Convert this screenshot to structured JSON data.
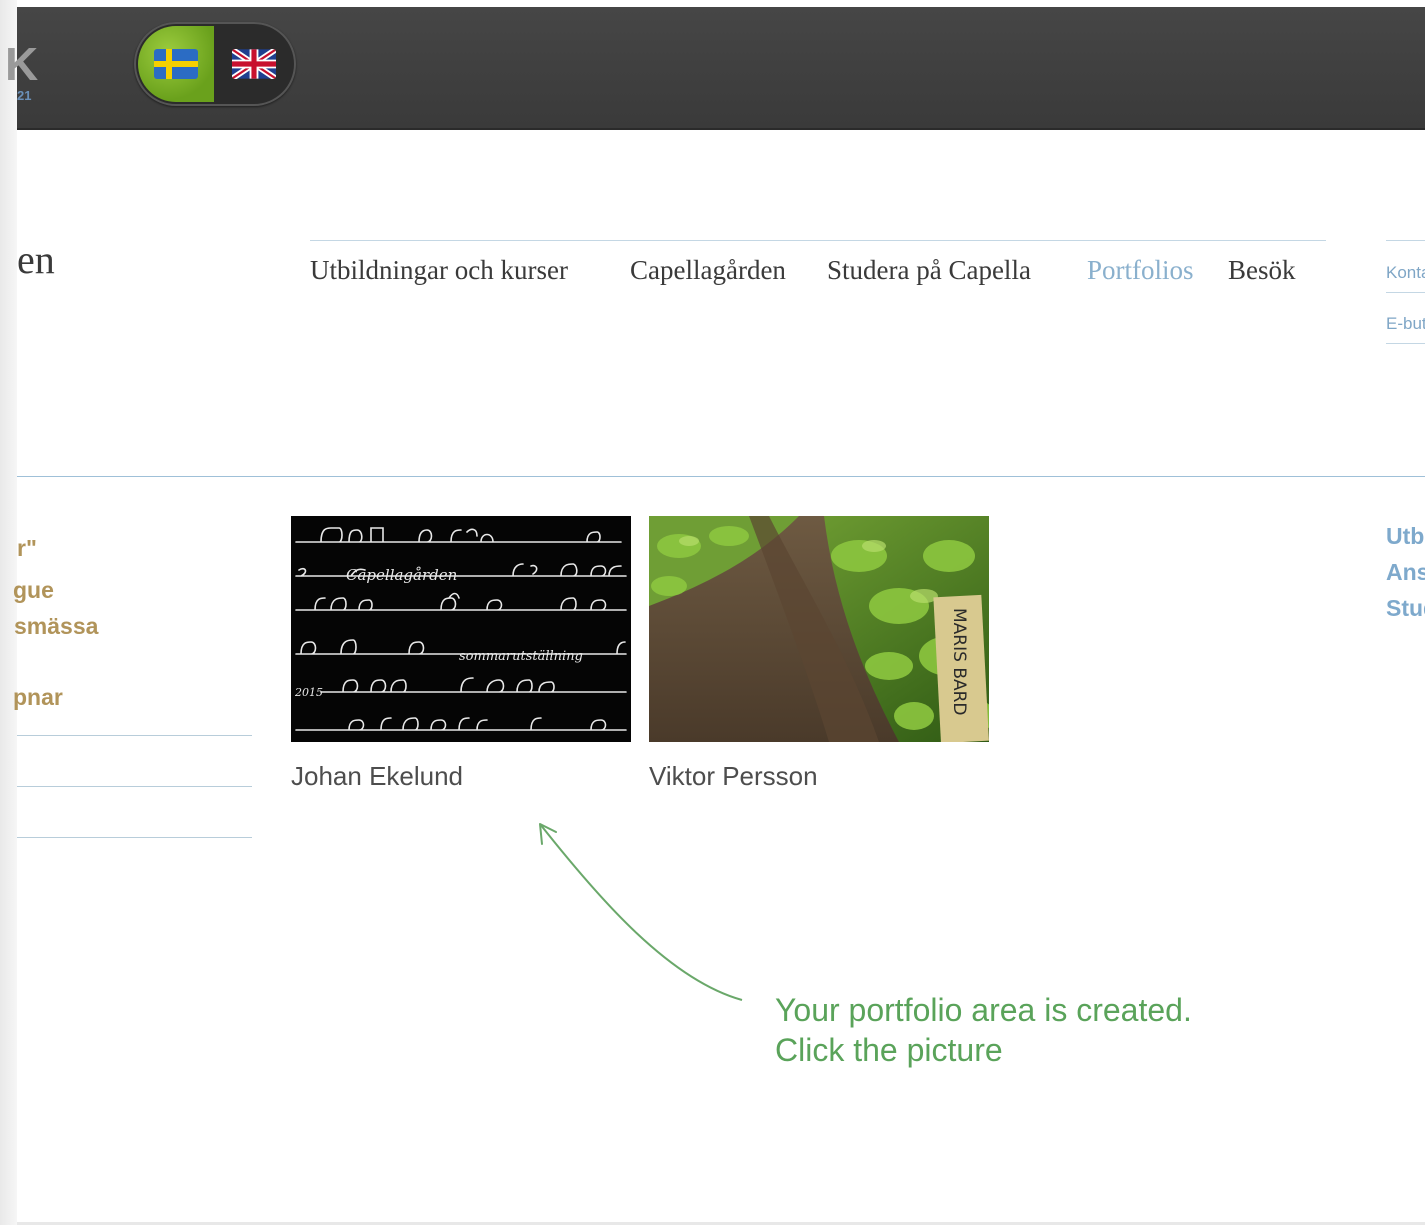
{
  "top_bar": {
    "logo_fragment": "K",
    "logo_number_fragment": "21",
    "language_switch": {
      "swedish": "swedish-flag",
      "english": "uk-flag"
    }
  },
  "site_title_fragment": "en",
  "main_nav": [
    {
      "label": "Utbildningar och kurser"
    },
    {
      "label": "Capellagården"
    },
    {
      "label": "Studera på Capella"
    },
    {
      "label": "Portfolios",
      "active": true
    },
    {
      "label": "Besök"
    }
  ],
  "utility_links": [
    "Kontakt",
    "E-butik"
  ],
  "side_news": [
    "r\"",
    "gue",
    "smässa",
    "pnar"
  ],
  "portfolios": [
    {
      "name": "Johan Ekelund"
    },
    {
      "name": "Viktor Persson"
    }
  ],
  "right_links": [
    "Utbildningar",
    "Ansökan",
    "Studera"
  ],
  "callout": {
    "line1": "Your portfolio area is created.",
    "line2": "Click the picture"
  },
  "colors": {
    "accent_blue": "#8ab0cd",
    "news_gold": "#b1945a",
    "callout_green": "#5aa35a",
    "top_bar": "#404040"
  }
}
